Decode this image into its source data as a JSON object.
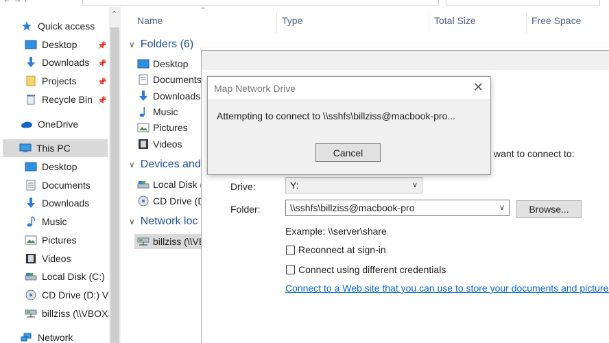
{
  "nav_pane": {
    "quick_access": "Quick access",
    "quick_items": [
      "Desktop",
      "Downloads",
      "Projects",
      "Recycle Bin"
    ],
    "onedrive": "OneDrive",
    "this_pc": "This PC",
    "pc_items": [
      "Desktop",
      "Documents",
      "Downloads",
      "Music",
      "Pictures",
      "Videos",
      "Local Disk (C:)",
      "CD Drive (D:) Vir",
      "billziss (\\\\VBOXS"
    ],
    "network": "Network"
  },
  "columns": {
    "name": "Name",
    "type": "Type",
    "total_size": "Total Size",
    "free_space": "Free Space"
  },
  "groups": {
    "folders": "Folders (6)",
    "folder_items": [
      "Desktop",
      "Documents",
      "Downloads",
      "Music",
      "Pictures",
      "Videos"
    ],
    "devices": "Devices and",
    "device_items": [
      "Local Disk (C",
      "CD Drive (D:"
    ],
    "network_locations": "Network loc",
    "network_items": [
      "billziss (\\\\VB"
    ]
  },
  "wizard": {
    "want_connect_text": "want to connect to:",
    "drive_label": "Drive:",
    "drive_value": "Y:",
    "folder_label": "Folder:",
    "folder_value": "\\\\sshfs\\billziss@macbook-pro",
    "browse_label": "Browse...",
    "example_text": "Example: \\\\server\\share",
    "reconnect_label": "Reconnect at sign-in",
    "credentials_label": "Connect using different credentials",
    "link_text": "Connect to a Web site that you can use to store your documents and pictures",
    "link_period": "."
  },
  "dialog": {
    "title": "Map Network Drive",
    "message": "Attempting to connect to \\\\sshfs\\billziss@macbook-pro...",
    "cancel_label": "Cancel"
  },
  "colors": {
    "accent": "#1e4e9b",
    "link": "#0066cc",
    "selection": "#d9d9d9"
  }
}
